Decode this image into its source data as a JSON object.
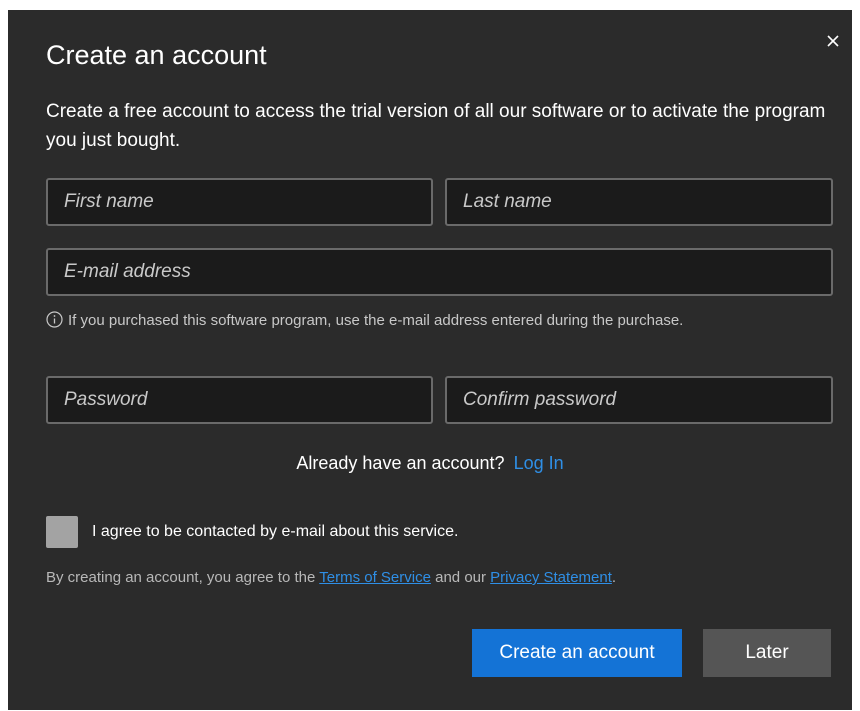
{
  "dialog": {
    "title": "Create an account",
    "description": "Create a free account to access the trial version of all our software or to activate the program you just bought.",
    "close_icon": "close-icon"
  },
  "form": {
    "first_name": {
      "placeholder": "First name",
      "value": ""
    },
    "last_name": {
      "placeholder": "Last name",
      "value": ""
    },
    "email": {
      "placeholder": "E-mail address",
      "value": ""
    },
    "email_hint": "If you purchased this software program, use the e-mail address entered during the purchase.",
    "email_hint_icon": "info-icon",
    "password": {
      "placeholder": "Password",
      "value": ""
    },
    "confirm_password": {
      "placeholder": "Confirm password",
      "value": ""
    }
  },
  "login": {
    "prompt": "Already have an account?",
    "link": "Log In"
  },
  "consent": {
    "checked": false,
    "label": "I agree to be contacted by e-mail about this service."
  },
  "terms": {
    "prefix": "By creating an account, you agree to the",
    "terms_link": "Terms of Service",
    "middle": "and our",
    "privacy_link": "Privacy Statement",
    "suffix": "."
  },
  "buttons": {
    "create": "Create an account",
    "later": "Later"
  },
  "colors": {
    "dialog_bg": "#2b2b2b",
    "field_bg": "#1b1b1b",
    "field_border": "#6a6a6a",
    "primary": "#1473d6",
    "secondary": "#555555",
    "link": "#2f8fe6",
    "checkbox": "#a3a3a3"
  }
}
